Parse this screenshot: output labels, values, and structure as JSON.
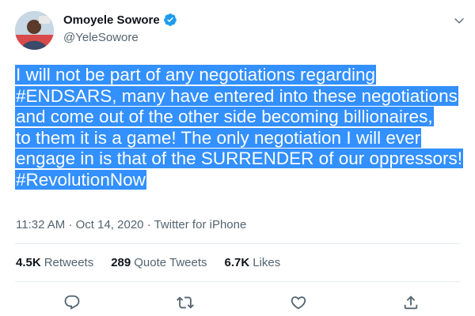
{
  "author": {
    "name": "Omoyele Sowore",
    "handle": "@YeleSowore"
  },
  "tweet": {
    "lines": [
      "I will not be part of any negotiations regarding",
      "#ENDSARS, many have entered into these negotiations",
      "and come out of the other side becoming billionaires,",
      "to them it is a game! The only negotiation I will ever",
      "engage in is that of the SURRENDER of our oppressors!",
      "#RevolutionNow"
    ],
    "time": "11:32 AM",
    "separator": "·",
    "date": "Oct 14, 2020",
    "source": "Twitter for iPhone"
  },
  "stats": {
    "retweets_count": "4.5K",
    "retweets_label": "Retweets",
    "quotes_count": "289",
    "quotes_label": "Quote Tweets",
    "likes_count": "6.7K",
    "likes_label": "Likes"
  },
  "icons": {
    "reply": "reply-icon",
    "retweet": "retweet-icon",
    "like": "heart-icon",
    "share": "share-icon",
    "more": "chevron-down-icon",
    "verified": "verified-badge-icon"
  },
  "colors": {
    "accent": "#1d9bf0",
    "highlight": "#3390ff",
    "secondary_text": "#536471",
    "divider": "#e6ecf0"
  }
}
